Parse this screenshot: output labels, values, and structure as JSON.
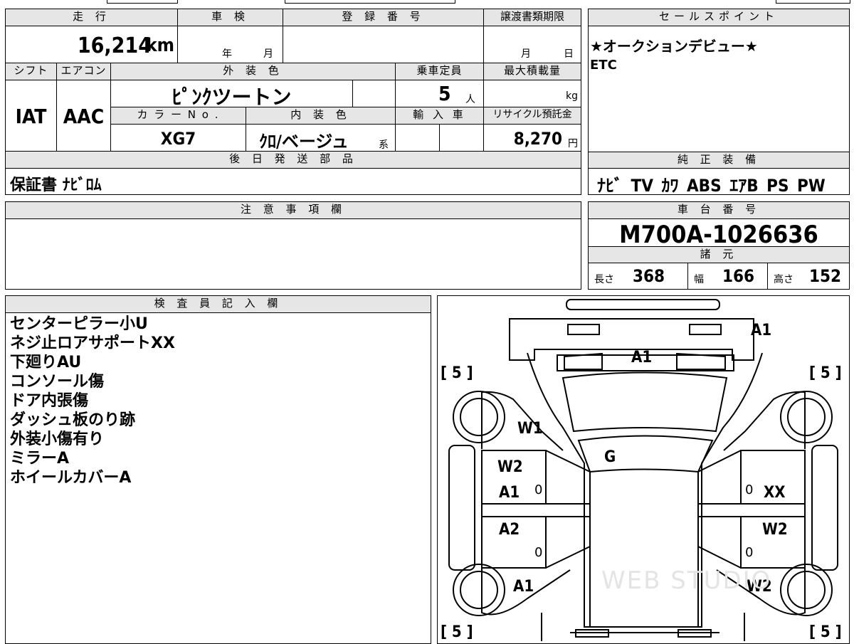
{
  "top": {
    "mileage_label": "走 行",
    "mileage": "16,214",
    "mileage_unit": "km",
    "shaken_label": "車 検",
    "shaken_year": "年",
    "shaken_month": "月",
    "registration_label": "登 録 番 号",
    "transfer_label": "譲渡書類期限",
    "transfer_month": "月",
    "transfer_day": "日"
  },
  "specs": {
    "shift_label": "シフト",
    "shift": "IAT",
    "aircon_label": "エアコン",
    "aircon": "AAC",
    "exterior_label": "外 装 色",
    "exterior": "ﾋﾟﾝｸツートン",
    "color_no_label": "カ ラ ー N o .",
    "color_no": "XG7",
    "interior_label": "内 装 色",
    "interior": "ｸﾛ/ベージュ",
    "interior_suffix": "系",
    "capacity_label": "乗車定員",
    "capacity": "5",
    "capacity_unit": "人",
    "import_label": "輸 入 車",
    "max_load_label": "最大積載量",
    "max_load_unit": "kg",
    "recycle_label": "リサイクル預託金",
    "recycle": "8,270",
    "recycle_unit": "円"
  },
  "parts": {
    "label": "後 日 発 送 部 品",
    "value": "保証書 ﾅﾋﾞﾛﾑ"
  },
  "sales": {
    "label": "セールスポイント",
    "line1": "★オークションデビュー★",
    "line2": "ETC"
  },
  "equipment": {
    "label": "純 正 装 備",
    "value": "ﾅﾋﾞ TV ｶﾜ ABS ｴｱB PS PW"
  },
  "notes": {
    "label": "注 意 事 項 欄"
  },
  "chassis": {
    "label": "車 台 番 号",
    "value": "M700A-1026636",
    "dims_label": "諸 元",
    "length_label": "長さ",
    "length": "368",
    "width_label": "幅",
    "width": "166",
    "height_label": "高さ",
    "height": "152"
  },
  "inspector": {
    "label": "検 査 員 記 入 欄",
    "lines": [
      "センターピラー小U",
      "ネジ止ロアサポートXX",
      "下廻りAU",
      "コンソール傷",
      "ドア内張傷",
      "ダッシュ板のり跡",
      "外装小傷有り",
      "ミラーA",
      "ホイールカバーA"
    ]
  },
  "diagram": {
    "tire_tl": "[ 5 ]",
    "tire_tr": "[ 5 ]",
    "tire_bl": "[ 5 ]",
    "tire_br": "[ 5 ]",
    "bumper": "A1",
    "windshield_top": "A1",
    "fender_left": "W1",
    "roof": "G",
    "front_door_left_1": "W2",
    "front_door_left_2": "A1",
    "front_door_right": "XX",
    "rear_door_left": "A2",
    "rear_door_right": "W2",
    "quarter_left": "A1",
    "quarter_right": "W2",
    "door_mark_0a": "0",
    "door_mark_0b": "0",
    "door_mark_0c": "0",
    "door_mark_0d": "0",
    "watermark": "WEB STUDIO"
  }
}
